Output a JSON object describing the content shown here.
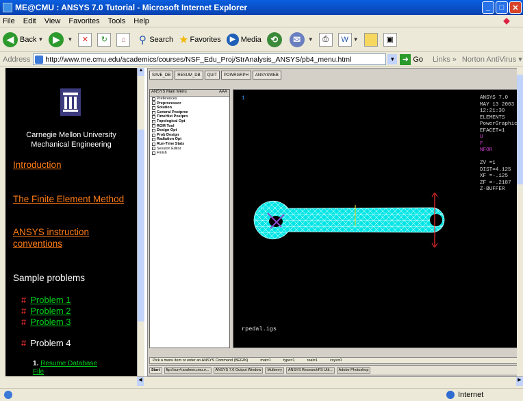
{
  "window": {
    "title": "ME@CMU : ANSYS 7.0 Tutorial - Microsoft Internet Explorer"
  },
  "menubar": [
    "File",
    "Edit",
    "View",
    "Favorites",
    "Tools",
    "Help"
  ],
  "toolbar": {
    "back": "Back",
    "search": "Search",
    "favorites": "Favorites",
    "media": "Media"
  },
  "address": {
    "label": "Address",
    "url": "http://www.me.cmu.edu/academics/courses/NSF_Edu_Proj/StrAnalysis_ANSYS/pb4_menu.html",
    "go": "Go",
    "links": "Links",
    "antivirus": "Norton AntiVirus"
  },
  "leftnav": {
    "university": "Carnegie Mellon University",
    "department": "Mechanical Engineering",
    "introduction": "Introduction",
    "fem": "The Finite Element Method",
    "conventions_1": "ANSYS instruction",
    "conventions_2": "conventions",
    "samples": "Sample problems",
    "problems": [
      "Problem 1",
      "Problem 2",
      "Problem 3"
    ],
    "problem4": "Problem 4",
    "hash": "#",
    "step1_num": "1.",
    "step1_a": "Resume Database",
    "step1_b": "File"
  },
  "ansys": {
    "toolbar": [
      "SAVE_DB",
      "RESUM_DB",
      "QUIT",
      "POWRGRPH",
      "ANSYSWEB"
    ],
    "menu_title": "ANSYS Main Menu",
    "menu_title_right": "AAA",
    "menu_items": [
      {
        "label": "Preferences",
        "bold": false
      },
      {
        "label": "Preprocessor",
        "bold": true
      },
      {
        "label": "Solution",
        "bold": true
      },
      {
        "label": "General Postproc",
        "bold": true
      },
      {
        "label": "TimeHist Postpro",
        "bold": true
      },
      {
        "label": "Topological Opt",
        "bold": true
      },
      {
        "label": "ROM Tool",
        "bold": true
      },
      {
        "label": "Design Opt",
        "bold": true
      },
      {
        "label": "Prob Design",
        "bold": true
      },
      {
        "label": "Radiation Opt",
        "bold": true
      },
      {
        "label": "Run-Time Stats",
        "bold": true
      },
      {
        "label": "Session Editor",
        "bold": false
      },
      {
        "label": "Finish",
        "bold": false
      }
    ],
    "window_number": "1",
    "info": [
      "ANSYS 7.0",
      "MAY 13 2003",
      "12:21:30",
      "ELEMENTS",
      "PowerGraphics",
      "EFACET=1",
      "U",
      "F",
      "NFOR",
      "",
      "ZV  =1",
      "DIST=4.125",
      "XF  =-.125",
      "ZF  =-.2187",
      "Z-BUFFER"
    ],
    "info_magenta": [
      6,
      7,
      8
    ],
    "filename": "rpedal.igs",
    "status": [
      "Pick a menu item or enter an ANSYS Command (BEGIN)",
      "mat=1",
      "type=1",
      "real=1",
      "csys=0"
    ],
    "taskbar": [
      "Start",
      "ftp://sun4.andrew.cmu.e...",
      "ANSYS 7.0 Output Window",
      "Mulberry",
      "ANSYS ResearchFS Util...",
      "Adobe Photoshop"
    ],
    "colors": {
      "mesh_fill": "#00e5e5",
      "mesh_line": "#ffffff",
      "background": "#000000",
      "accent_magenta": "#d040d0"
    }
  },
  "status": {
    "zone": "Internet"
  }
}
